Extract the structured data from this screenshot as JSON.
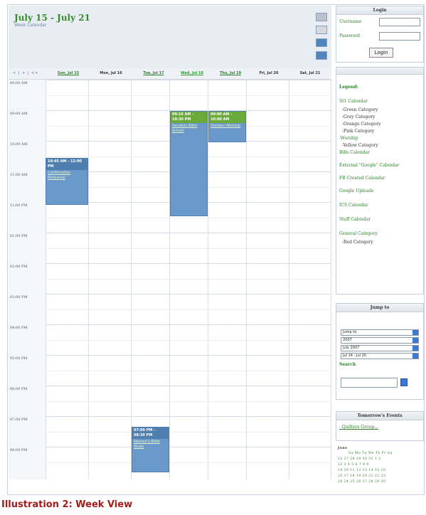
{
  "calendar": {
    "title": "July 15 - July 21",
    "subtitle": "Week Calendar",
    "nav": "< | > | <<",
    "days": [
      "Sun, Jul 15",
      "Mon, Jul 16",
      "Tue, Jul 17",
      "Wed, Jul 18",
      "Thu, Jul 19",
      "Fri, Jul 20",
      "Sat, Jul 21"
    ],
    "times": [
      "08:00 AM",
      "09:00 AM",
      "10:00 AM",
      "11:00 AM",
      "12:00 PM",
      "01:00 PM",
      "02:00 PM",
      "03:00 PM",
      "04:00 PM",
      "05:00 PM",
      "06:00 PM",
      "07:00 PM",
      "08:00 PM"
    ],
    "events": [
      {
        "time": "10:45 AM - 12:00 PM",
        "name": "Confirmation Rehearsal"
      },
      {
        "time": "09:15 AM - 10:30 PM",
        "name": "Vacation Bible School"
      },
      {
        "time": "09:00 AM - 10:00 AM",
        "name": "Outdoor Worship"
      },
      {
        "time": "07:00 PM - 08:30 PM",
        "name": "Women's Bible Study"
      }
    ]
  },
  "login": {
    "title": "Login",
    "username_label": "Username",
    "password_label": "Password",
    "button": "Login"
  },
  "legend": {
    "title": "Legend:",
    "items": [
      {
        "label": "St1 Calendar",
        "type": "g"
      },
      {
        "label": "-Green Category",
        "type": "k"
      },
      {
        "label": "-Grey Category",
        "type": "k"
      },
      {
        "label": "-Orange Category",
        "type": "k"
      },
      {
        "label": "-Pink Category",
        "type": "k"
      },
      {
        "label": "-Worship",
        "type": "g"
      },
      {
        "label": "-Yellow Category",
        "type": "k"
      },
      {
        "label": "Bills Calendar",
        "type": "g"
      },
      {
        "label": "External \"Google\" Calendar",
        "type": "g"
      },
      {
        "label": "FB Created Calendar",
        "type": "g"
      },
      {
        "label": "Google Uploads",
        "type": "g"
      },
      {
        "label": "ICS Calendar",
        "type": "g"
      },
      {
        "label": "Staff Calendar",
        "type": "g"
      },
      {
        "label": "General Category",
        "type": "g"
      },
      {
        "label": "-Red Category",
        "type": "k"
      }
    ]
  },
  "jump": {
    "title": "Jump to",
    "selects": [
      "Jump to",
      "2007",
      "July 2007",
      "Jul 14 - Jul 20"
    ],
    "search_label": "Search"
  },
  "tomorrow": {
    "title": "Tomorrow's Events",
    "event": "- Quilters Group..."
  },
  "mini": {
    "header": "June",
    "days": "Su Mo Tu We Th Fr Sa",
    "rows": [
      "22  27  28  29  30  31   1   2",
      "23   3   4   5   6   7   8   9",
      "24 10  11  12  13  14  15  16",
      "25 17  18  19  20  21  22  23",
      "26 24  25  26  27  28  29  30"
    ]
  },
  "caption": "Illustration 2: Week View"
}
